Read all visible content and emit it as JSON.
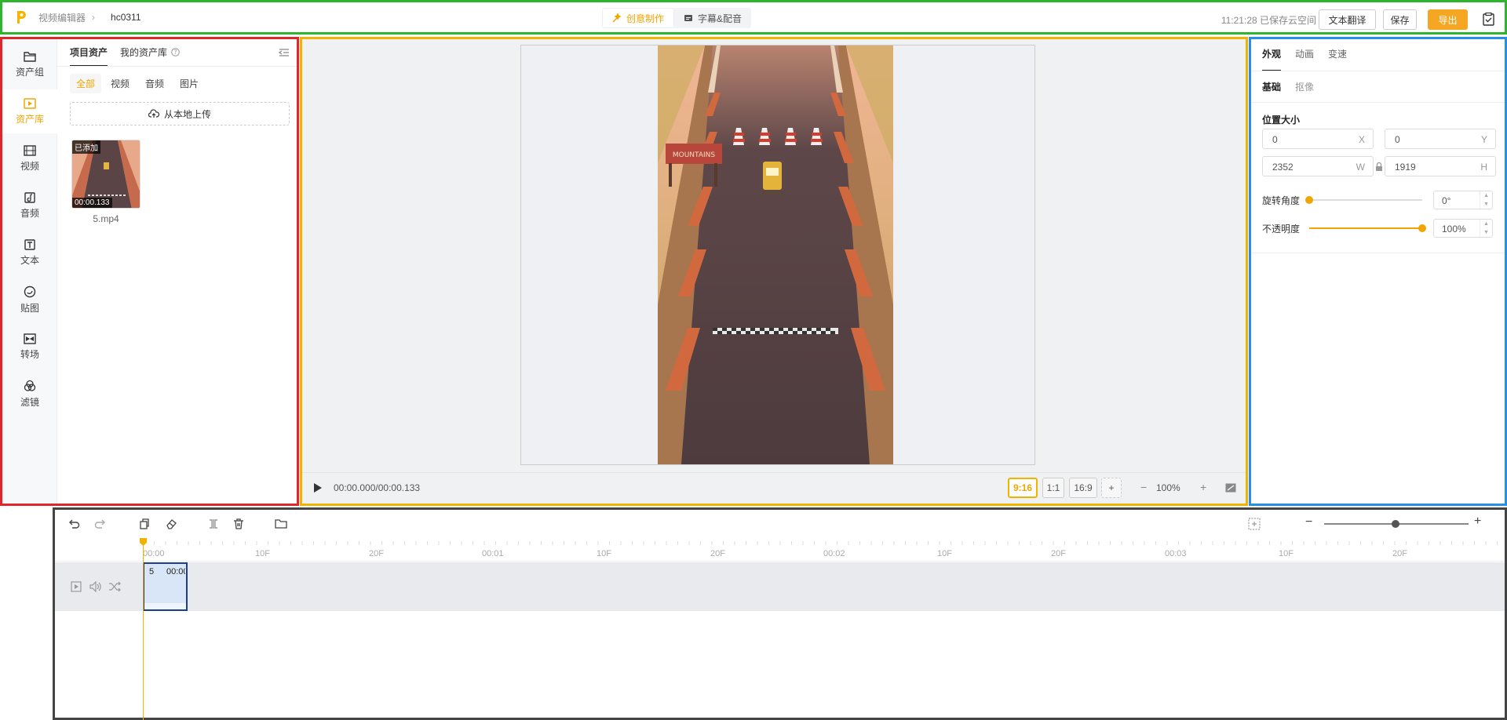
{
  "header": {
    "breadcrumb": "视频编辑器",
    "project_name": "hc0311",
    "mode_tabs": [
      {
        "label": "创意制作",
        "active": true
      },
      {
        "label": "字幕&配音",
        "active": false
      }
    ],
    "save_status": "11:21:28 已保存云空间",
    "translate_label": "文本翻译",
    "save_label": "保存",
    "export_label": "导出",
    "accent_color": "#f5a623"
  },
  "sidebar": {
    "items": [
      {
        "label": "资产组",
        "icon": "folder-icon"
      },
      {
        "label": "资产库",
        "icon": "play-square-icon",
        "active": true
      },
      {
        "label": "视频",
        "icon": "film-icon"
      },
      {
        "label": "音频",
        "icon": "music-icon"
      },
      {
        "label": "文本",
        "icon": "text-icon"
      },
      {
        "label": "贴图",
        "icon": "sticker-icon"
      },
      {
        "label": "转场",
        "icon": "transition-icon"
      },
      {
        "label": "滤镜",
        "icon": "filter-icon"
      }
    ]
  },
  "assets": {
    "tabs": [
      {
        "label": "项目资产",
        "active": true
      },
      {
        "label": "我的资产库",
        "active": false
      }
    ],
    "filters": [
      {
        "label": "全部",
        "active": true
      },
      {
        "label": "视频"
      },
      {
        "label": "音频"
      },
      {
        "label": "图片"
      }
    ],
    "upload_label": "从本地上传",
    "items": [
      {
        "name": "5.mp4",
        "badge": "已添加",
        "duration": "00:00.133"
      }
    ]
  },
  "preview": {
    "time": "00:00.000/00:00.133",
    "ratios": [
      {
        "label": "9:16",
        "active": true
      },
      {
        "label": "1:1"
      },
      {
        "label": "16:9"
      },
      {
        "label": "+"
      }
    ],
    "zoom": "100%",
    "sign_text": "MOUNTAINS"
  },
  "properties": {
    "tabs": [
      {
        "label": "外观",
        "active": true
      },
      {
        "label": "动画"
      },
      {
        "label": "变速"
      }
    ],
    "sub_tabs": [
      {
        "label": "基础",
        "active": true
      },
      {
        "label": "抠像"
      }
    ],
    "section_title": "位置大小",
    "x": "0",
    "x_unit": "X",
    "y": "0",
    "y_unit": "Y",
    "w": "2352",
    "w_unit": "W",
    "h": "1919",
    "h_unit": "H",
    "rotation_label": "旋转角度",
    "rotation": "0°",
    "rotation_fraction": 0.0,
    "opacity_label": "不透明度",
    "opacity": "100%",
    "opacity_fraction": 1.0
  },
  "timeline": {
    "ticks": [
      "00:00",
      "10F",
      "20F",
      "00:01",
      "10F",
      "20F",
      "00:02",
      "10F",
      "20F",
      "00:03",
      "10F",
      "20F"
    ],
    "clip": {
      "name": "5",
      "time": "00:00"
    }
  }
}
